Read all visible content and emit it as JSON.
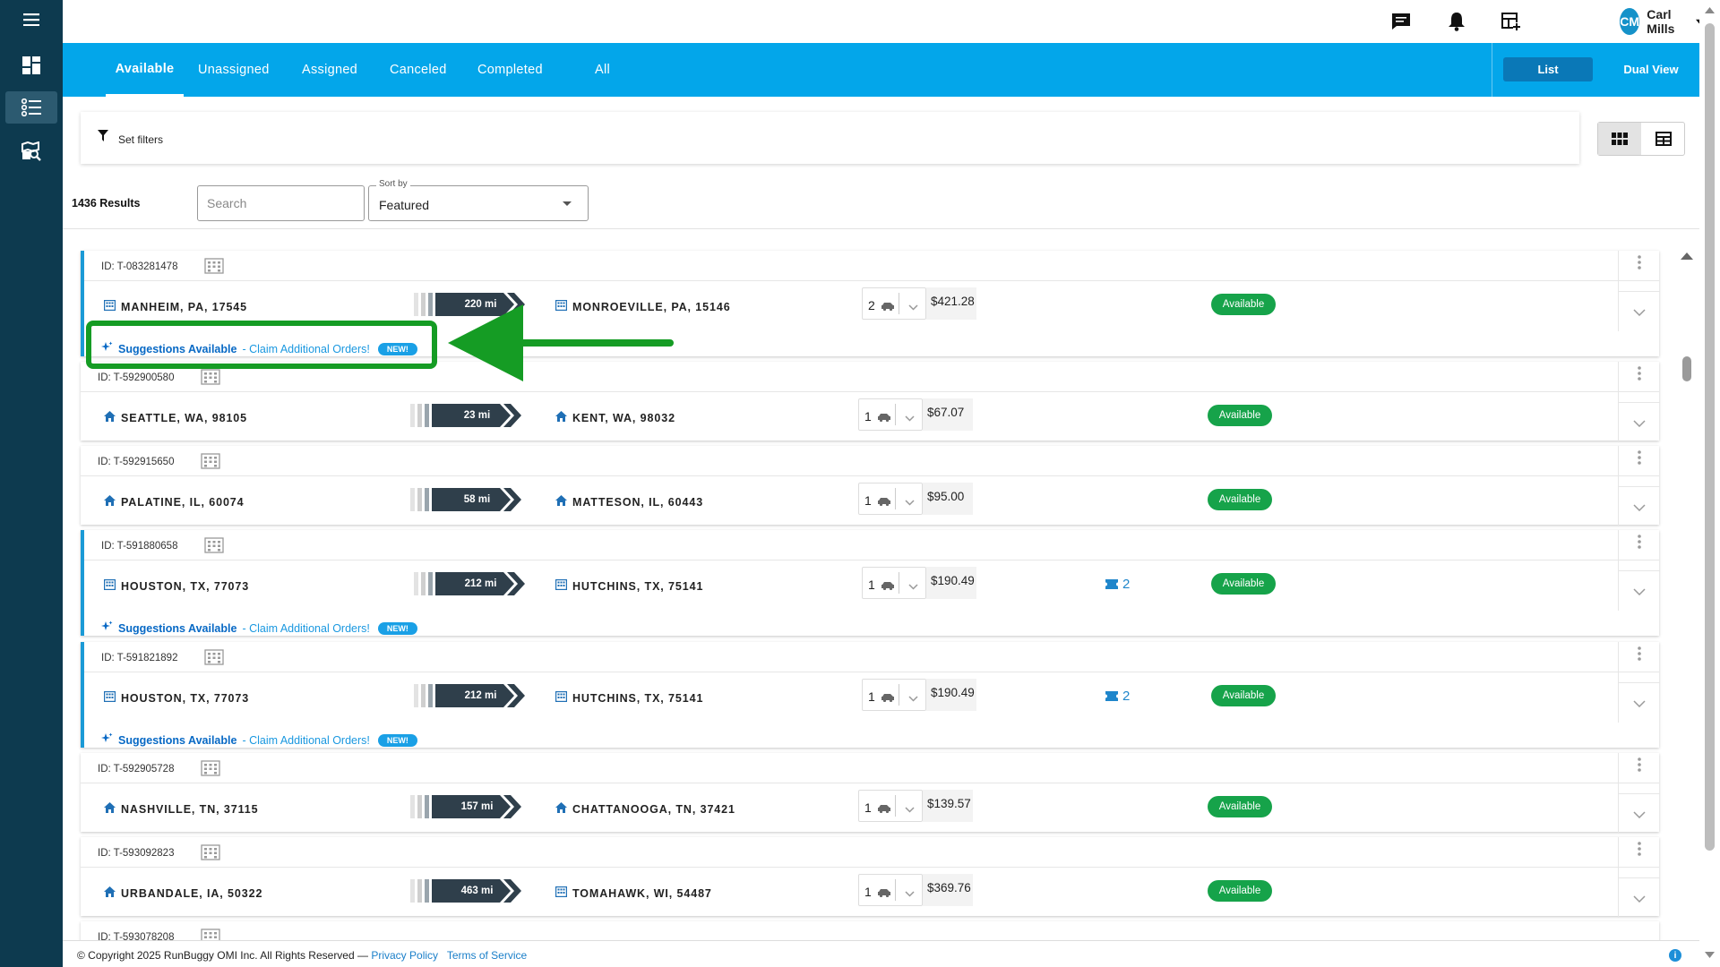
{
  "topbar": {
    "user_initials": "CM",
    "user_name": "Carl Mills"
  },
  "tabs": [
    "Available",
    "Unassigned",
    "Assigned",
    "Canceled",
    "Completed",
    "All"
  ],
  "view_toggle": {
    "list_label": "List",
    "dual_label": "Dual View"
  },
  "filters": {
    "set_filters_label": "Set filters"
  },
  "results": {
    "count_label": "1436 Results",
    "search_placeholder": "Search",
    "sort_label": "Sort by",
    "sort_value": "Featured"
  },
  "suggestion": {
    "title": "Suggestions Available",
    "link": "- Claim Additional Orders!",
    "badge": "NEW!"
  },
  "orders": [
    {
      "id": "ID: T-083281478",
      "origin": "MANHEIM, PA, 17545",
      "origin_icon": "building-icon",
      "distance": "220 mi",
      "destination": "MONROEVILLE, PA, 15146",
      "dest_icon": "building-icon",
      "qty": "2",
      "price": "$421.28",
      "status": "Available",
      "suggestion": true,
      "tickets": ""
    },
    {
      "id": "ID: T-592900580",
      "origin": "SEATTLE, WA, 98105",
      "origin_icon": "home-icon",
      "distance": "23 mi",
      "destination": "KENT, WA, 98032",
      "dest_icon": "home-icon",
      "qty": "1",
      "price": "$67.07",
      "status": "Available",
      "suggestion": false,
      "tickets": ""
    },
    {
      "id": "ID: T-592915650",
      "origin": "PALATINE, IL, 60074",
      "origin_icon": "home-icon",
      "distance": "58 mi",
      "destination": "MATTESON, IL, 60443",
      "dest_icon": "home-icon",
      "qty": "1",
      "price": "$95.00",
      "status": "Available",
      "suggestion": false,
      "tickets": ""
    },
    {
      "id": "ID: T-591880658",
      "origin": "HOUSTON, TX, 77073",
      "origin_icon": "building-icon",
      "distance": "212 mi",
      "destination": "HUTCHINS, TX, 75141",
      "dest_icon": "building-icon",
      "qty": "1",
      "price": "$190.49",
      "status": "Available",
      "suggestion": true,
      "tickets": "2"
    },
    {
      "id": "ID: T-591821892",
      "origin": "HOUSTON, TX, 77073",
      "origin_icon": "building-icon",
      "distance": "212 mi",
      "destination": "HUTCHINS, TX, 75141",
      "dest_icon": "building-icon",
      "qty": "1",
      "price": "$190.49",
      "status": "Available",
      "suggestion": true,
      "tickets": "2"
    },
    {
      "id": "ID: T-592905728",
      "origin": "NASHVILLE, TN, 37115",
      "origin_icon": "home-icon",
      "distance": "157 mi",
      "destination": "CHATTANOOGA, TN, 37421",
      "dest_icon": "home-icon",
      "qty": "1",
      "price": "$139.57",
      "status": "Available",
      "suggestion": false,
      "tickets": ""
    },
    {
      "id": "ID: T-593092823",
      "origin": "URBANDALE, IA, 50322",
      "origin_icon": "home-icon",
      "distance": "463 mi",
      "destination": "TOMAHAWK, WI, 54487",
      "dest_icon": "building-icon",
      "qty": "1",
      "price": "$369.76",
      "status": "Available",
      "suggestion": false,
      "tickets": ""
    },
    {
      "id": "ID: T-593078208",
      "origin": "",
      "origin_icon": "home-icon",
      "distance": "",
      "destination": "",
      "dest_icon": "home-icon",
      "qty": "",
      "price": "",
      "status": "",
      "suggestion": false,
      "tickets": ""
    }
  ],
  "footer": {
    "copyright": "© Copyright 2025 RunBuggy OMI Inc. All Rights Reserved —",
    "privacy": "Privacy Policy",
    "terms": "Terms of Service"
  },
  "colors": {
    "sidebar": "#0d3a4f",
    "tabbar": "#03a6ea",
    "available": "#16a34a",
    "highlight": "#159c24",
    "distance_chip": "#2f3f4b"
  }
}
